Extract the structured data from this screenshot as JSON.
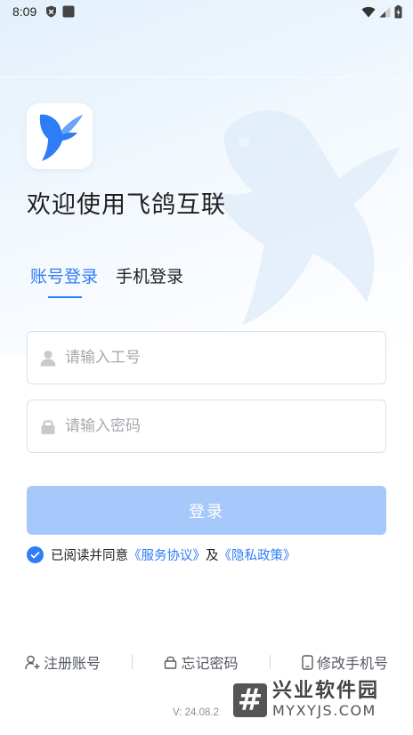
{
  "status_bar": {
    "time": "8:09"
  },
  "welcome_title": "欢迎使用飞鸽互联",
  "tabs": [
    {
      "label": "账号登录",
      "active": true
    },
    {
      "label": "手机登录",
      "active": false
    }
  ],
  "form": {
    "account_placeholder": "请输入工号",
    "account_value": "",
    "password_placeholder": "请输入密码",
    "password_value": "",
    "login_label": "登录"
  },
  "agreement": {
    "checked": true,
    "prefix": "已阅读并同意",
    "service_link": "《服务协议》",
    "and": "及",
    "privacy_link": "《隐私政策》"
  },
  "bottom_links": {
    "register": "注册账号",
    "forgot": "忘记密码",
    "change_phone": "修改手机号"
  },
  "version": "V: 24.08.2",
  "watermark": {
    "cn": "兴业软件园",
    "en": "MYXYJS.COM"
  },
  "colors": {
    "accent": "#2e7cf6",
    "button_disabled": "#a7c8fb",
    "text": "#1f1f1f",
    "muted": "#555a61"
  }
}
